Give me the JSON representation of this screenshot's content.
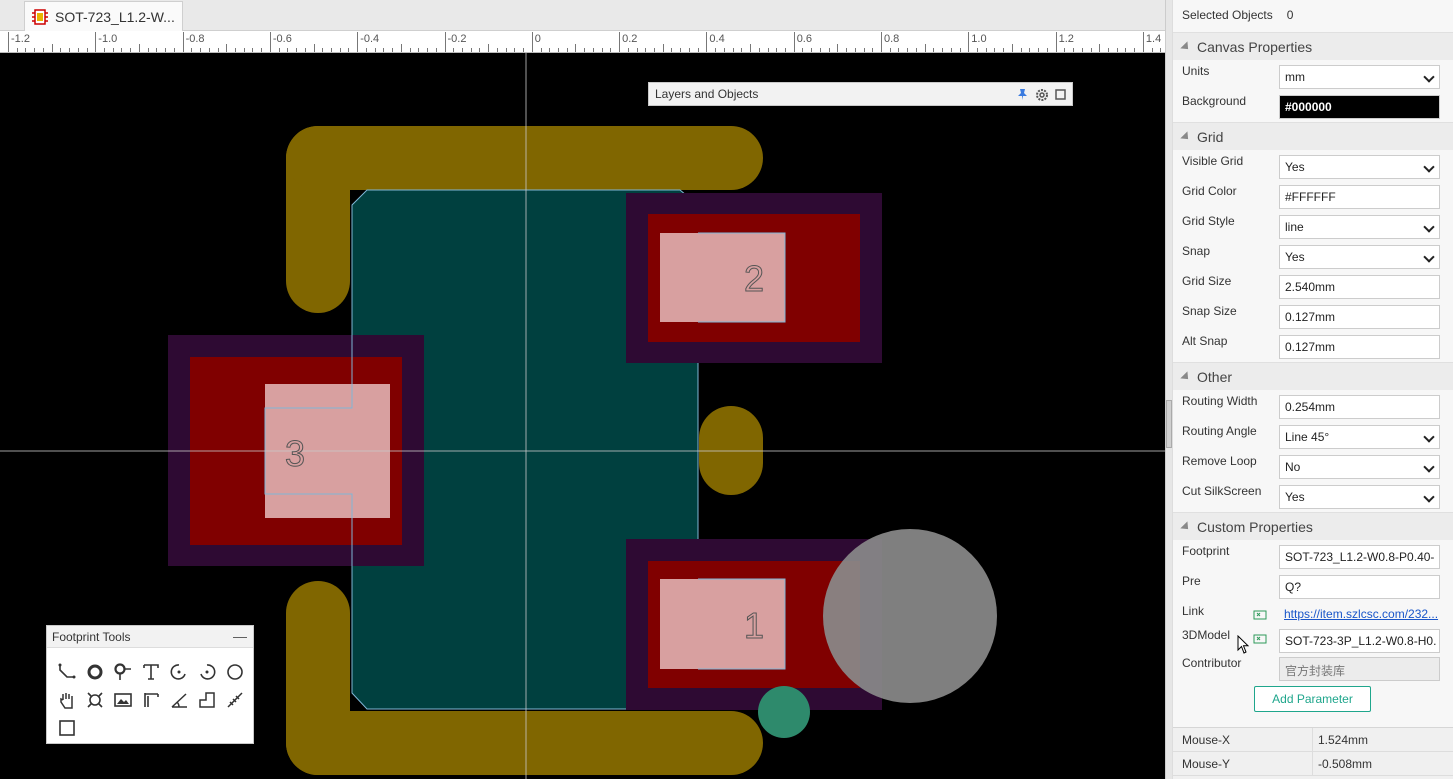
{
  "tab": {
    "title": "SOT-723_L1.2-W..."
  },
  "ruler": {
    "labels": [
      "-1.2",
      "-1.0",
      "-0.8",
      "-0.6",
      "-0.4",
      "-0.2",
      "0",
      "0.2",
      "0.4",
      "0.6",
      "0.8",
      "1.0",
      "1.2",
      "1.4"
    ]
  },
  "canvas": {
    "background": "#000000",
    "pads": [
      {
        "number": "2"
      },
      {
        "number": "3"
      },
      {
        "number": "1"
      }
    ]
  },
  "layers_panel": {
    "title": "Layers and Objects"
  },
  "footprint_tools": {
    "title": "Footprint Tools",
    "minimize": "—",
    "tools": [
      "track-icon",
      "pad-icon",
      "via-icon",
      "text-icon",
      "arc-icon",
      "arc-ccw-icon",
      "circle-icon",
      "pan-hand-icon",
      "hole-icon",
      "image-icon",
      "dimension-icon",
      "angle-icon",
      "polygon-icon",
      "measure-icon",
      "rectangle-icon"
    ]
  },
  "properties": {
    "selected_objects_label": "Selected Objects",
    "selected_objects_value": "0",
    "canvas_section": "Canvas Properties",
    "units": {
      "label": "Units",
      "value": "mm"
    },
    "background": {
      "label": "Background",
      "value": "#000000"
    },
    "grid_section": "Grid",
    "visible_grid": {
      "label": "Visible Grid",
      "value": "Yes"
    },
    "grid_color": {
      "label": "Grid Color",
      "value": "#FFFFFF"
    },
    "grid_style": {
      "label": "Grid Style",
      "value": "line"
    },
    "snap": {
      "label": "Snap",
      "value": "Yes"
    },
    "grid_size": {
      "label": "Grid Size",
      "value": "2.540mm"
    },
    "snap_size": {
      "label": "Snap Size",
      "value": "0.127mm"
    },
    "alt_snap": {
      "label": "Alt Snap",
      "value": "0.127mm"
    },
    "other_section": "Other",
    "routing_width": {
      "label": "Routing Width",
      "value": "0.254mm"
    },
    "routing_angle": {
      "label": "Routing Angle",
      "value": "Line 45°"
    },
    "remove_loop": {
      "label": "Remove Loop",
      "value": "No"
    },
    "cut_silkscreen": {
      "label": "Cut SilkScreen",
      "value": "Yes"
    },
    "custom_section": "Custom Properties",
    "footprint": {
      "label": "Footprint",
      "value": "SOT-723_L1.2-W0.8-P0.40-"
    },
    "pre": {
      "label": "Pre",
      "value": "Q?"
    },
    "link": {
      "label": "Link",
      "value": "https://item.szlcsc.com/232..."
    },
    "model3d": {
      "label": "3DModel",
      "value": "SOT-723-3P_L1.2-W0.8-H0."
    },
    "contributor": {
      "label": "Contributor",
      "value": "官方封装库"
    },
    "add_parameter": "Add Parameter"
  },
  "status": {
    "mouse_x": {
      "label": "Mouse-X",
      "value": "1.524mm"
    },
    "mouse_y": {
      "label": "Mouse-Y",
      "value": "-0.508mm"
    }
  },
  "colors": {
    "silkscreen": "#806600",
    "body": "#00403F",
    "pad_outer": "#2E0A33",
    "pad_red": "#800000",
    "pad_pink": "#D8A0A0",
    "accent": "#1FA68C"
  }
}
